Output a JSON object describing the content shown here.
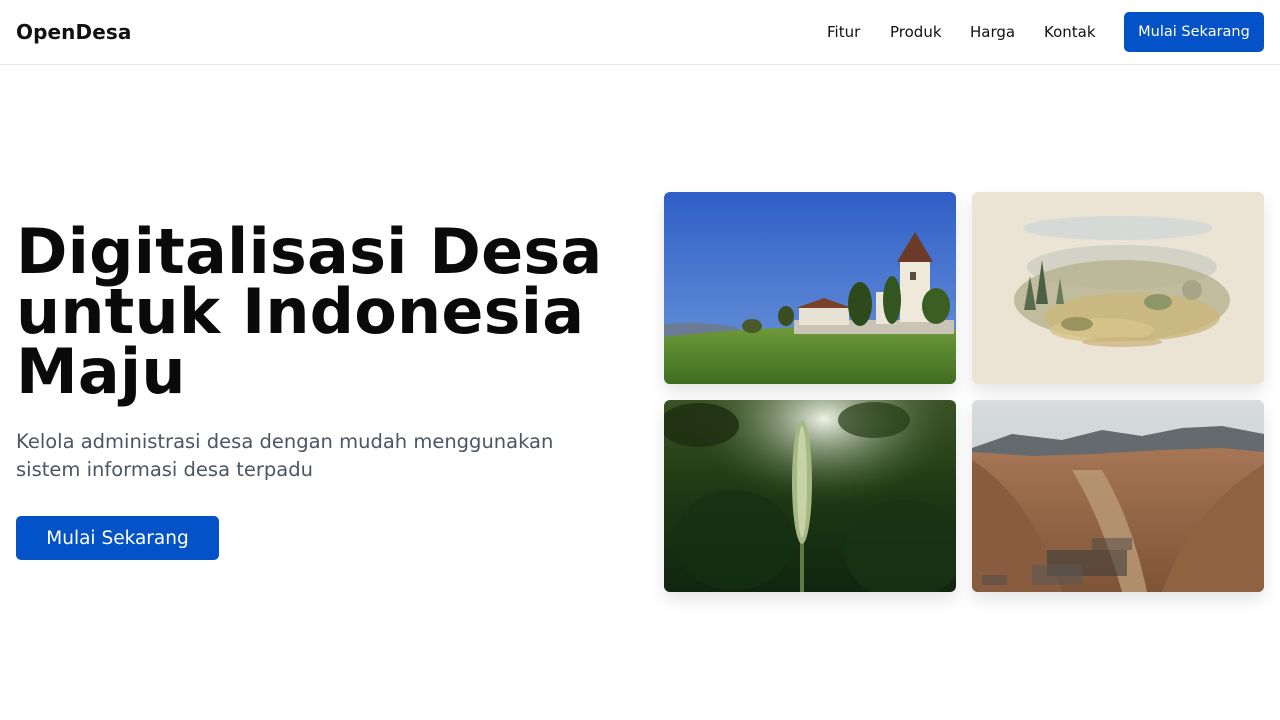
{
  "header": {
    "brand": "OpenDesa",
    "nav": [
      "Fitur",
      "Produk",
      "Harga",
      "Kontak"
    ],
    "cta_label": "Mulai Sekarang"
  },
  "hero": {
    "title": "Digitalisasi Desa untuk Indonesia Maju",
    "subtitle": "Kelola administrasi desa dengan mudah menggunakan sistem informasi desa terpadu",
    "cta_label": "Mulai Sekarang"
  },
  "gallery": {
    "images": [
      "village-church-on-grassy-hill-photo",
      "watercolor-landscape-illustration",
      "close-up-grass-seed-head-photo",
      "aerial-valley-town-between-mountains-photo"
    ]
  },
  "colors": {
    "primary": "#0452c8",
    "text": "#111111",
    "muted": "#4b5563",
    "border": "#e5e7eb"
  }
}
